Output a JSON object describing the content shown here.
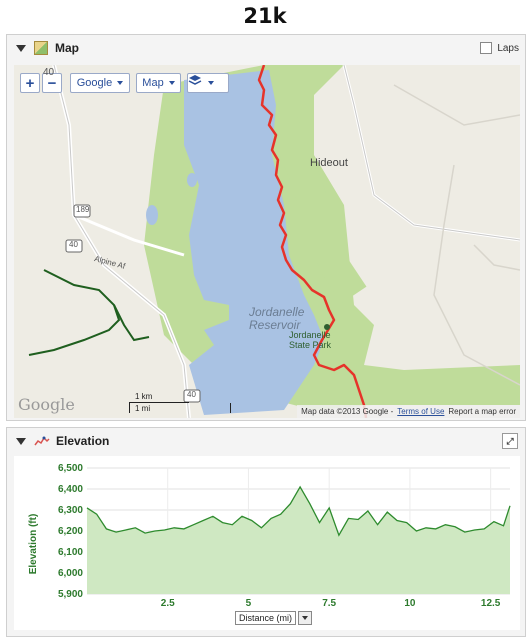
{
  "page_title": "21k",
  "map_panel": {
    "title": "Map",
    "laps_label": "Laps",
    "zoom_in": "+",
    "zoom_out": "−",
    "provider_dropdown": "Google",
    "type_dropdown": "Map",
    "layers_icon": "layers-icon",
    "labels": {
      "hideout": "Hideout",
      "reservoir_line1": "Jordanelle",
      "reservoir_line2": "Reservoir",
      "park_line1": "Jordanelle",
      "park_line2": "State Park",
      "road_40_top": "40",
      "road_189": "189",
      "road_40_mid": "40",
      "road_40_bottom": "40",
      "alpine": "Alpine Af"
    },
    "google_logo": "Google",
    "scale_km": "1 km",
    "scale_mi": "1 mi",
    "attribution": "Map data ©2013 Google -",
    "terms": "Terms of Use",
    "report": "Report a map error",
    "colors": {
      "water": "#a9c2e3",
      "park": "#bfdc9a",
      "route": "#e6332a",
      "trail": "#1f5f1f"
    }
  },
  "elevation_panel": {
    "title": "Elevation",
    "expand_icon": "expand-icon",
    "x_selector_label": "Distance (mi)"
  },
  "chart_data": {
    "type": "area",
    "title": "",
    "xlabel": "Distance (mi)",
    "ylabel": "Elevation (ft)",
    "xlim": [
      0,
      13.1
    ],
    "ylim": [
      5900,
      6500
    ],
    "x_ticks": [
      "2.5",
      "5",
      "7.5",
      "10",
      "12.5"
    ],
    "y_ticks": [
      "6,500",
      "6,400",
      "6,300",
      "6,200",
      "6,100",
      "6,000",
      "5,900"
    ],
    "grid": true,
    "color": "#2e8b2e",
    "fill": "#cfe8c2",
    "x": [
      0,
      0.3,
      0.6,
      0.9,
      1.2,
      1.5,
      1.8,
      2.1,
      2.4,
      2.7,
      3.0,
      3.3,
      3.6,
      3.9,
      4.2,
      4.5,
      4.8,
      5.1,
      5.4,
      5.7,
      6.0,
      6.3,
      6.6,
      6.9,
      7.2,
      7.5,
      7.8,
      8.1,
      8.4,
      8.7,
      9.0,
      9.3,
      9.6,
      9.9,
      10.2,
      10.5,
      10.8,
      11.1,
      11.4,
      11.7,
      12.0,
      12.3,
      12.6,
      12.9,
      13.1
    ],
    "y": [
      6310,
      6280,
      6210,
      6195,
      6205,
      6215,
      6190,
      6200,
      6205,
      6215,
      6210,
      6230,
      6250,
      6270,
      6240,
      6230,
      6270,
      6250,
      6215,
      6260,
      6280,
      6330,
      6410,
      6330,
      6240,
      6310,
      6180,
      6260,
      6255,
      6295,
      6230,
      6290,
      6250,
      6240,
      6200,
      6215,
      6210,
      6230,
      6220,
      6195,
      6205,
      6210,
      6245,
      6225,
      6320
    ]
  }
}
